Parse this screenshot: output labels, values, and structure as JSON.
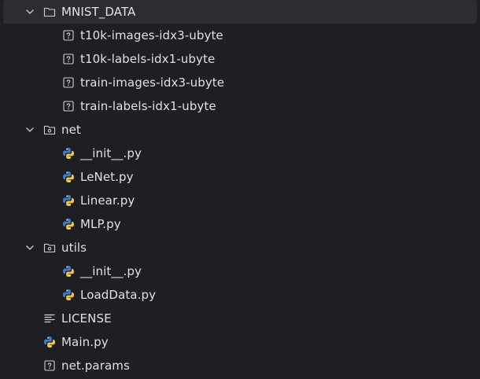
{
  "project_tree": {
    "items": [
      {
        "label": "MNIST_DATA",
        "icon": "folder-icon",
        "level": 1,
        "expandable": true,
        "expanded": true
      },
      {
        "label": "t10k-images-idx3-ubyte",
        "icon": "unknown-file-icon",
        "level": 2
      },
      {
        "label": "t10k-labels-idx1-ubyte",
        "icon": "unknown-file-icon",
        "level": 2
      },
      {
        "label": "train-images-idx3-ubyte",
        "icon": "unknown-file-icon",
        "level": 2
      },
      {
        "label": "train-labels-idx1-ubyte",
        "icon": "unknown-file-icon",
        "level": 2
      },
      {
        "label": "net",
        "icon": "package-icon",
        "level": 1,
        "expandable": true,
        "expanded": true
      },
      {
        "label": "__init__.py",
        "icon": "python-file-icon",
        "level": 2
      },
      {
        "label": "LeNet.py",
        "icon": "python-file-icon",
        "level": 2
      },
      {
        "label": "Linear.py",
        "icon": "python-file-icon",
        "level": 2
      },
      {
        "label": "MLP.py",
        "icon": "python-file-icon",
        "level": 2
      },
      {
        "label": "utils",
        "icon": "package-icon",
        "level": 1,
        "expandable": true,
        "expanded": true
      },
      {
        "label": "__init__.py",
        "icon": "python-file-icon",
        "level": 2
      },
      {
        "label": "LoadData.py",
        "icon": "python-file-icon",
        "level": 2
      },
      {
        "label": "LICENSE",
        "icon": "text-file-icon",
        "level": 1
      },
      {
        "label": "Main.py",
        "icon": "python-file-icon",
        "level": 1
      },
      {
        "label": "net.params",
        "icon": "unknown-file-icon",
        "level": 1
      }
    ]
  },
  "colors": {
    "background": "#1e1f22",
    "selection": "#2b2d30",
    "text": "#dfe1e5",
    "icon_gray": "#ced0d6",
    "python_blue": "#3f7cc4",
    "python_yellow": "#f4c542"
  }
}
